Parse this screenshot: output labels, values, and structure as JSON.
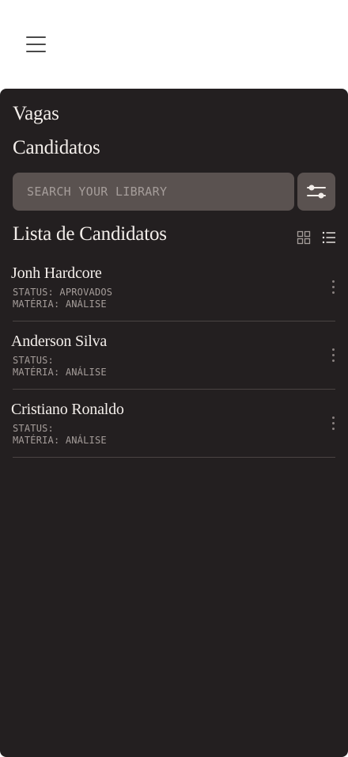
{
  "nav": {
    "menu_icon": "hamburger-menu-icon",
    "links": [
      {
        "label": "Vagas"
      },
      {
        "label": "Candidatos"
      }
    ]
  },
  "search": {
    "placeholder": "SEARCH YOUR LIBRARY",
    "value": "",
    "filter_icon": "sliders-filter-icon"
  },
  "list": {
    "title": "Lista de Candidatos",
    "view_icons": [
      "grid-view-icon",
      "list-view-icon"
    ],
    "candidates": [
      {
        "name": "Jonh Hardcore",
        "status": "STATUS: APROVADOS",
        "materia": "MATÉRIA: ANÁLISE"
      },
      {
        "name": "Anderson Silva",
        "status": "STATUS:",
        "materia": "MATÉRIA: ANÁLISE"
      },
      {
        "name": "Cristiano Ronaldo",
        "status": "STATUS:",
        "materia": "MATÉRIA: ANÁLISE"
      }
    ]
  },
  "colors": {
    "panel_bg": "#231f20",
    "input_bg": "#5a5250",
    "text_primary": "#f3eeea",
    "text_muted": "#a59d9a"
  }
}
